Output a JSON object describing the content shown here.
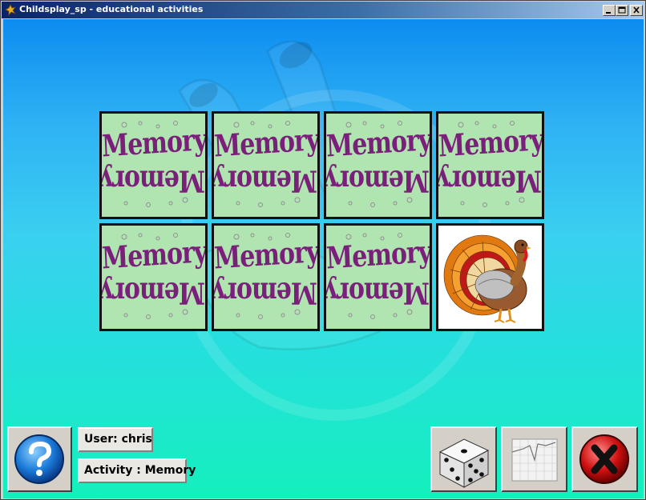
{
  "window": {
    "title": "Childsplay_sp - educational activities"
  },
  "status": {
    "user_label": "User: chris",
    "activity_label": "Activity : Memory"
  },
  "cards": [
    {
      "state": "face-down",
      "face_text": "Memory"
    },
    {
      "state": "face-down",
      "face_text": "Memory"
    },
    {
      "state": "face-down",
      "face_text": "Memory"
    },
    {
      "state": "face-down",
      "face_text": "Memory"
    },
    {
      "state": "face-down",
      "face_text": "Memory"
    },
    {
      "state": "face-down",
      "face_text": "Memory"
    },
    {
      "state": "face-down",
      "face_text": "Memory"
    },
    {
      "state": "face-up",
      "picture": "turkey-icon"
    }
  ],
  "icons": {
    "help": "question-mark-icon",
    "dice": "dice-icon",
    "graph": "graph-icon",
    "quit": "close-x-icon"
  },
  "colors": {
    "card_back": "#b0e4b0",
    "memory_text": "#7a1f7a",
    "quit_red": "#d01010",
    "help_blue": "#1a7ad8"
  }
}
